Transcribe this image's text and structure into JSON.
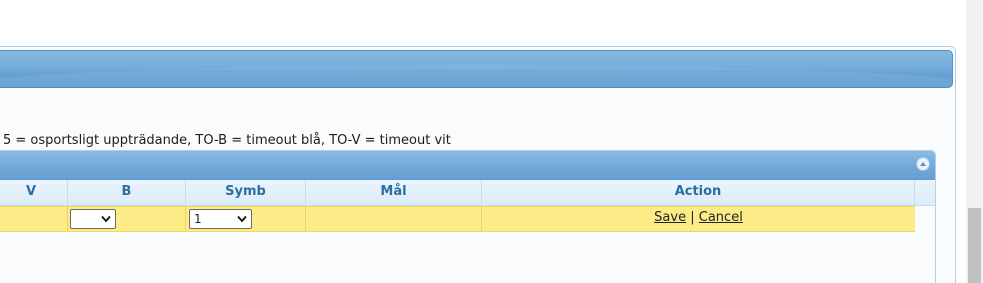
{
  "legend": {
    "text": "5 = osportsligt uppträdande, TO-B = timeout blå, TO-V = timeout vit"
  },
  "grid": {
    "columns": [
      "V",
      "B",
      "Symb",
      "Mål",
      "Action"
    ],
    "edit_row": {
      "b_select_value": "",
      "symb_select_value": "1",
      "save_label": "Save",
      "separator": "|",
      "cancel_label": "Cancel"
    }
  },
  "colors": {
    "header_blue": "#6aa4d6",
    "column_header_text": "#2e6e9e",
    "edit_row_bg": "#fbec88"
  }
}
